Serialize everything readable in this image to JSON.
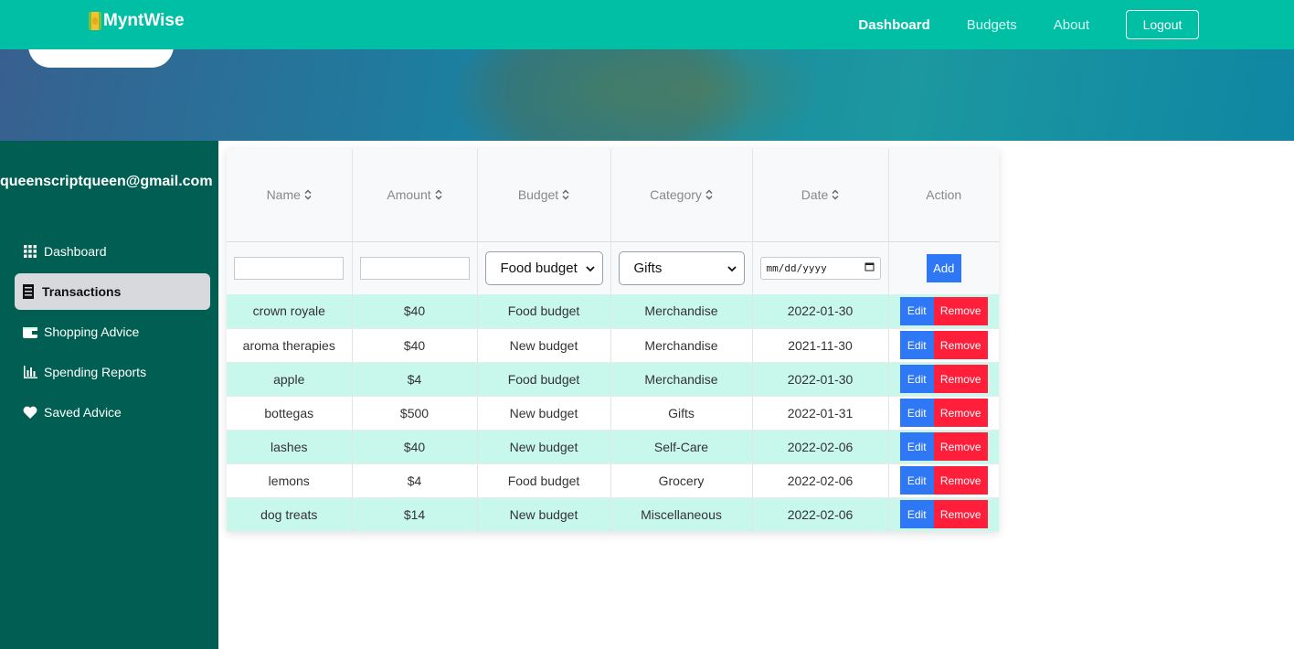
{
  "nav": {
    "brand": "MyntWise",
    "links": [
      "Dashboard",
      "Budgets",
      "About"
    ],
    "logout": "Logout"
  },
  "sidebar": {
    "user_email": "queenscriptqueen@gmail.com",
    "items": [
      {
        "label": "Dashboard",
        "icon": "grid-icon"
      },
      {
        "label": "Transactions",
        "icon": "receipt-icon"
      },
      {
        "label": "Shopping Advice",
        "icon": "wallet-icon"
      },
      {
        "label": "Spending Reports",
        "icon": "bar-chart-icon"
      },
      {
        "label": "Saved Advice",
        "icon": "heart-icon"
      }
    ],
    "active_index": 1
  },
  "table": {
    "headers": [
      "Name",
      "Amount",
      "Budget",
      "Category",
      "Date",
      "Action"
    ],
    "filters": {
      "budget_selected": "Food budget",
      "category_selected": "Gifts",
      "date_placeholder": "mm/dd/yyyy",
      "add_label": "Add"
    },
    "edit_label": "Edit",
    "remove_label": "Remove",
    "rows": [
      {
        "name": "crown royale",
        "amount": "$40",
        "budget": "Food budget",
        "category": "Merchandise",
        "date": "2022-01-30"
      },
      {
        "name": "aroma therapies",
        "amount": "$40",
        "budget": "New budget",
        "category": "Merchandise",
        "date": "2021-11-30"
      },
      {
        "name": "apple",
        "amount": "$4",
        "budget": "Food budget",
        "category": "Merchandise",
        "date": "2022-01-30"
      },
      {
        "name": "bottegas",
        "amount": "$500",
        "budget": "New budget",
        "category": "Gifts",
        "date": "2022-01-31"
      },
      {
        "name": "lashes",
        "amount": "$40",
        "budget": "New budget",
        "category": "Self-Care",
        "date": "2022-02-06"
      },
      {
        "name": "lemons",
        "amount": "$4",
        "budget": "Food budget",
        "category": "Grocery",
        "date": "2022-02-06"
      },
      {
        "name": "dog treats",
        "amount": "$14",
        "budget": "New budget",
        "category": "Miscellaneous",
        "date": "2022-02-06"
      }
    ]
  },
  "colors": {
    "navbar": "#00bfa5",
    "sidebar": "#005f52",
    "row_highlight": "#c8f7ec",
    "primary_button": "#2f78f5",
    "danger_button": "#ff1f3a"
  }
}
